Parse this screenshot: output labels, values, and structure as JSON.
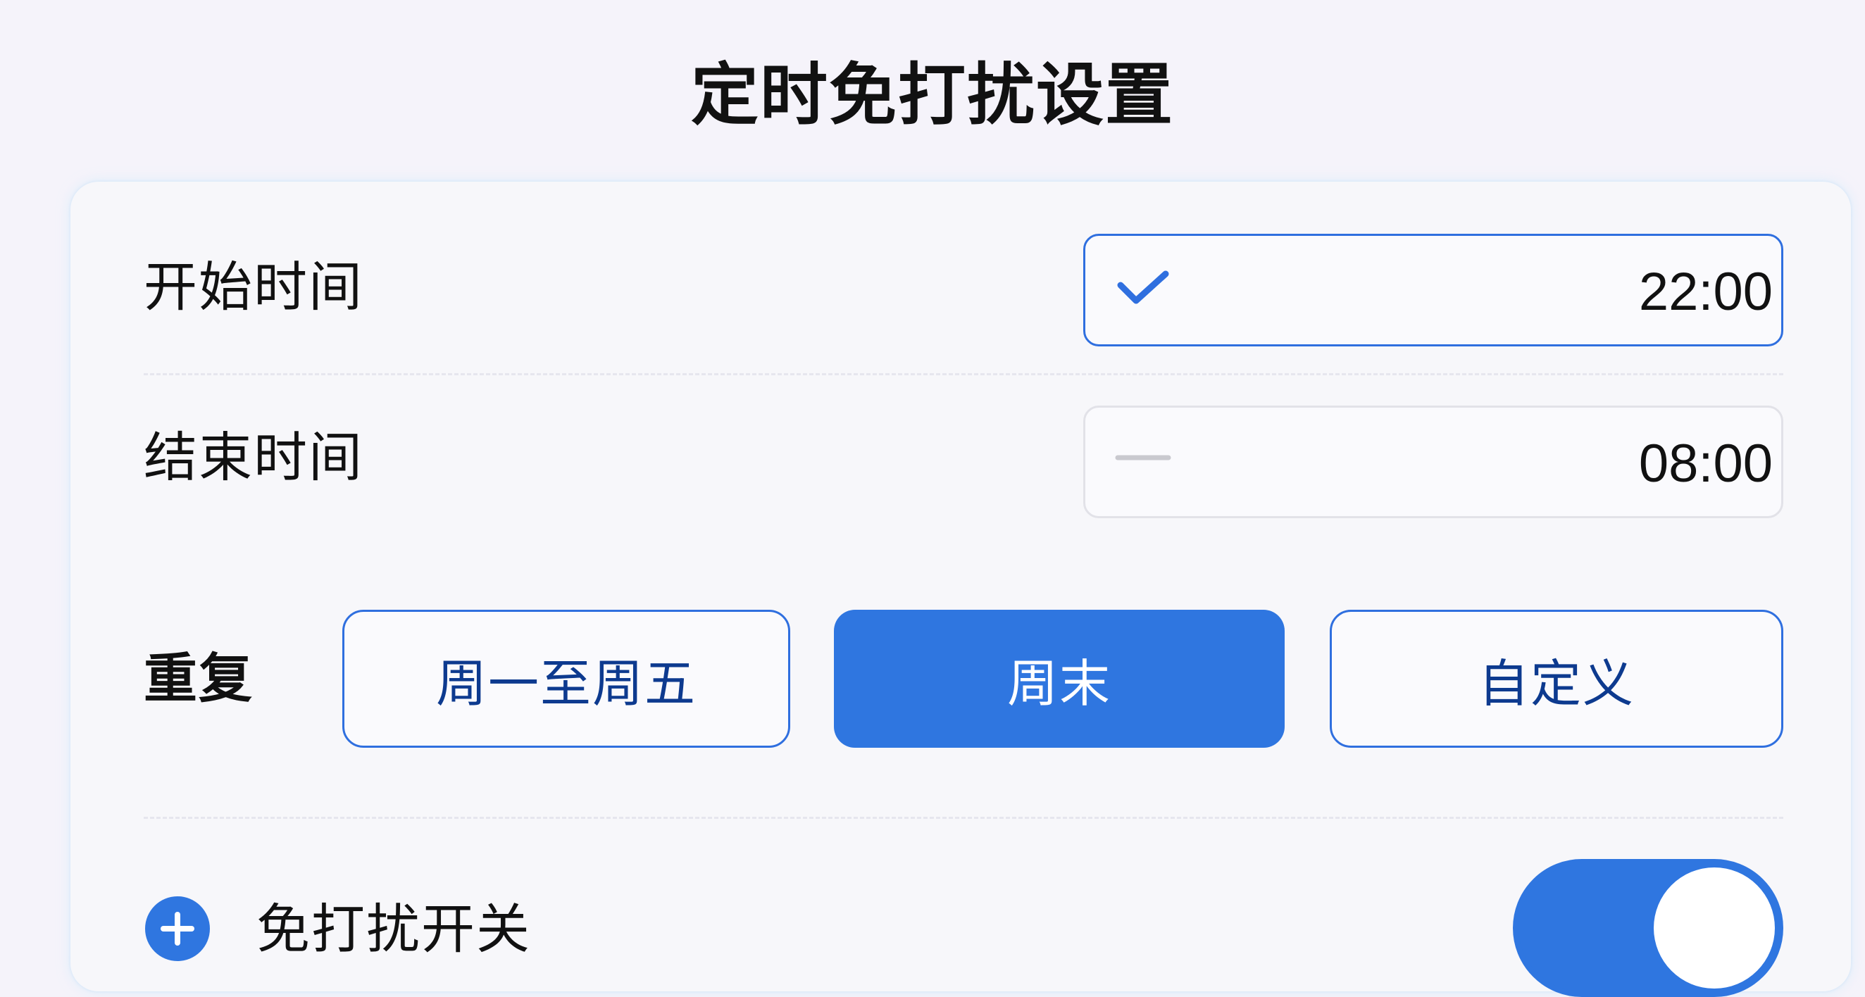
{
  "page": {
    "title": "定时免打扰设置"
  },
  "settings": {
    "start_time": {
      "label": "开始时间",
      "value": "22:00",
      "status_icon": "checkmark-icon"
    },
    "end_time": {
      "label": "结束时间",
      "value": "08:00",
      "status_icon": "dash-icon"
    },
    "repeat": {
      "label": "重复",
      "options": [
        {
          "label": "周一至周五",
          "selected": false
        },
        {
          "label": "周末",
          "selected": true
        },
        {
          "label": "自定义",
          "selected": false
        }
      ]
    },
    "dnd_toggle": {
      "label": "免打扰开关",
      "icon": "plus-circle-icon",
      "enabled": true
    }
  },
  "colors": {
    "accent": "#2f76e0",
    "accent_dark_text": "#0d3a8f",
    "background": "#f5f3fa",
    "card": "#f7f7fa"
  }
}
